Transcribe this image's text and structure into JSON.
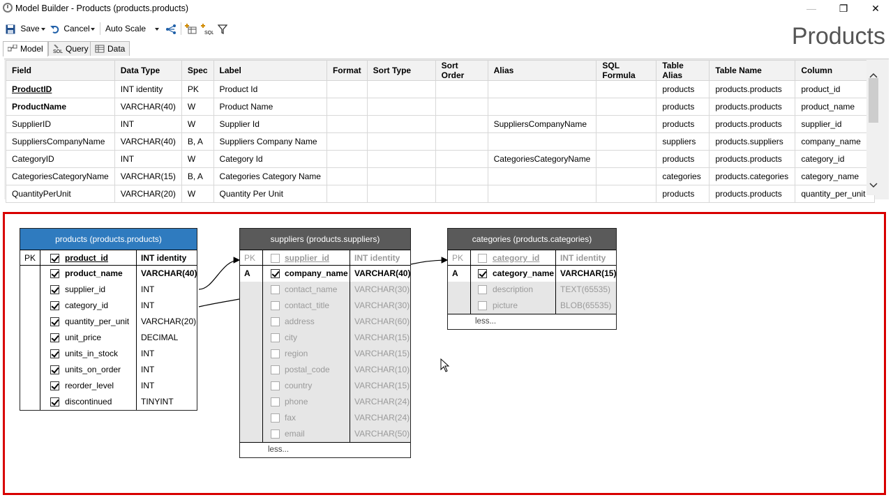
{
  "window": {
    "title": "Model Builder - Products (products.products)",
    "minimize": "—",
    "restore": "❐",
    "close": "✕"
  },
  "toolbar": {
    "save_label": "Save",
    "cancel_label": "Cancel",
    "autoscale_label": "Auto Scale"
  },
  "page_title": "Products",
  "tabs": [
    {
      "label": "Model"
    },
    {
      "label": "Query"
    },
    {
      "label": "Data"
    }
  ],
  "grid": {
    "columns": [
      "Field",
      "Data Type",
      "Spec",
      "Label",
      "Format",
      "Sort Type",
      "Sort Order",
      "Alias",
      "SQL Formula",
      "Table Alias",
      "Table Name",
      "Column"
    ],
    "rows": [
      [
        "ProductID",
        "INT identity",
        "PK",
        "Product Id",
        "",
        "",
        "",
        "",
        "",
        "products",
        "products.products",
        "product_id"
      ],
      [
        "ProductName",
        "VARCHAR(40)",
        "W",
        "Product Name",
        "",
        "",
        "",
        "",
        "",
        "products",
        "products.products",
        "product_name"
      ],
      [
        "SupplierID",
        "INT",
        "W",
        "Supplier Id",
        "",
        "",
        "",
        "SuppliersCompanyName",
        "",
        "products",
        "products.products",
        "supplier_id"
      ],
      [
        "SuppliersCompanyName",
        "VARCHAR(40)",
        "B, A",
        "Suppliers Company Name",
        "",
        "",
        "",
        "",
        "",
        "suppliers",
        "products.suppliers",
        "company_name"
      ],
      [
        "CategoryID",
        "INT",
        "W",
        "Category Id",
        "",
        "",
        "",
        "CategoriesCategoryName",
        "",
        "products",
        "products.products",
        "category_id"
      ],
      [
        "CategoriesCategoryName",
        "VARCHAR(15)",
        "B, A",
        "Categories Category Name",
        "",
        "",
        "",
        "",
        "",
        "categories",
        "products.categories",
        "category_name"
      ],
      [
        "QuantityPerUnit",
        "VARCHAR(20)",
        "W",
        "Quantity Per Unit",
        "",
        "",
        "",
        "",
        "",
        "products",
        "products.products",
        "quantity_per_unit"
      ]
    ]
  },
  "diagram": {
    "tables": [
      {
        "title": "products (products.products)",
        "header_color": "#2f7bbf",
        "pk_label": "PK",
        "fields": [
          {
            "key": "PK",
            "checked": true,
            "name": "product_id",
            "type": "INT identity",
            "style": "pk"
          },
          {
            "key": "",
            "checked": true,
            "name": "product_name",
            "type": "VARCHAR(40)",
            "style": "bold"
          },
          {
            "key": "",
            "checked": true,
            "name": "supplier_id",
            "type": "INT",
            "style": "normal"
          },
          {
            "key": "",
            "checked": true,
            "name": "category_id",
            "type": "INT",
            "style": "normal"
          },
          {
            "key": "",
            "checked": true,
            "name": "quantity_per_unit",
            "type": "VARCHAR(20)",
            "style": "normal"
          },
          {
            "key": "",
            "checked": true,
            "name": "unit_price",
            "type": "DECIMAL",
            "style": "normal"
          },
          {
            "key": "",
            "checked": true,
            "name": "units_in_stock",
            "type": "INT",
            "style": "normal"
          },
          {
            "key": "",
            "checked": true,
            "name": "units_on_order",
            "type": "INT",
            "style": "normal"
          },
          {
            "key": "",
            "checked": true,
            "name": "reorder_level",
            "type": "INT",
            "style": "normal"
          },
          {
            "key": "",
            "checked": true,
            "name": "discontinued",
            "type": "TINYINT",
            "style": "normal"
          }
        ]
      },
      {
        "title": "suppliers (products.suppliers)",
        "header_color": "#5a5a5a",
        "less_label": "less...",
        "fields": [
          {
            "key": "PK",
            "checked": false,
            "name": "supplier_id",
            "type": "INT identity",
            "style": "pkdim"
          },
          {
            "key": "A",
            "checked": true,
            "name": "company_name",
            "type": "VARCHAR(40)",
            "style": "bold"
          },
          {
            "key": "",
            "checked": false,
            "name": "contact_name",
            "type": "VARCHAR(30)",
            "style": "dim"
          },
          {
            "key": "",
            "checked": false,
            "name": "contact_title",
            "type": "VARCHAR(30)",
            "style": "dim"
          },
          {
            "key": "",
            "checked": false,
            "name": "address",
            "type": "VARCHAR(60)",
            "style": "dim"
          },
          {
            "key": "",
            "checked": false,
            "name": "city",
            "type": "VARCHAR(15)",
            "style": "dim"
          },
          {
            "key": "",
            "checked": false,
            "name": "region",
            "type": "VARCHAR(15)",
            "style": "dim"
          },
          {
            "key": "",
            "checked": false,
            "name": "postal_code",
            "type": "VARCHAR(10)",
            "style": "dim"
          },
          {
            "key": "",
            "checked": false,
            "name": "country",
            "type": "VARCHAR(15)",
            "style": "dim"
          },
          {
            "key": "",
            "checked": false,
            "name": "phone",
            "type": "VARCHAR(24)",
            "style": "dim"
          },
          {
            "key": "",
            "checked": false,
            "name": "fax",
            "type": "VARCHAR(24)",
            "style": "dim"
          },
          {
            "key": "",
            "checked": false,
            "name": "email",
            "type": "VARCHAR(50)",
            "style": "dim"
          }
        ]
      },
      {
        "title": "categories (products.categories)",
        "header_color": "#5a5a5a",
        "less_label": "less...",
        "fields": [
          {
            "key": "PK",
            "checked": false,
            "name": "category_id",
            "type": "INT identity",
            "style": "pkdim"
          },
          {
            "key": "A",
            "checked": true,
            "name": "category_name",
            "type": "VARCHAR(15)",
            "style": "bold"
          },
          {
            "key": "",
            "checked": false,
            "name": "description",
            "type": "TEXT(65535)",
            "style": "dim"
          },
          {
            "key": "",
            "checked": false,
            "name": "picture",
            "type": "BLOB(65535)",
            "style": "dim"
          }
        ]
      }
    ]
  }
}
